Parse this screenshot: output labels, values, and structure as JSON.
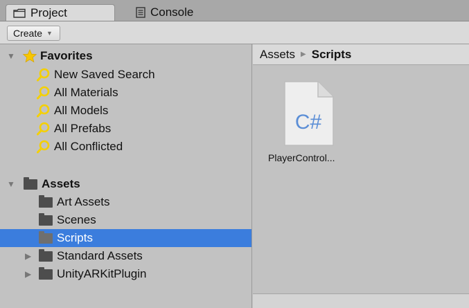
{
  "tabs": [
    {
      "label": "Project",
      "icon": "folder-icon",
      "active": true
    },
    {
      "label": "Console",
      "icon": "console-icon",
      "active": false
    }
  ],
  "toolbar": {
    "create_label": "Create"
  },
  "favorites": {
    "label": "Favorites",
    "items": [
      {
        "label": "New Saved Search"
      },
      {
        "label": "All Materials"
      },
      {
        "label": "All Models"
      },
      {
        "label": "All Prefabs"
      },
      {
        "label": "All Conflicted"
      }
    ]
  },
  "assets": {
    "label": "Assets",
    "items": [
      {
        "label": "Art Assets"
      },
      {
        "label": "Scenes"
      },
      {
        "label": "Scripts",
        "selected": true
      },
      {
        "label": "Standard Assets",
        "expandable": true
      },
      {
        "label": "UnityARKitPlugin",
        "expandable": true
      }
    ]
  },
  "breadcrumb": {
    "root": "Assets",
    "current": "Scripts"
  },
  "files": [
    {
      "badge": "C#",
      "label": "PlayerControl..."
    }
  ],
  "colors": {
    "selection": "#3b7ddd",
    "csharp": "#5b8ed6",
    "search_icon": "#f5d000"
  }
}
